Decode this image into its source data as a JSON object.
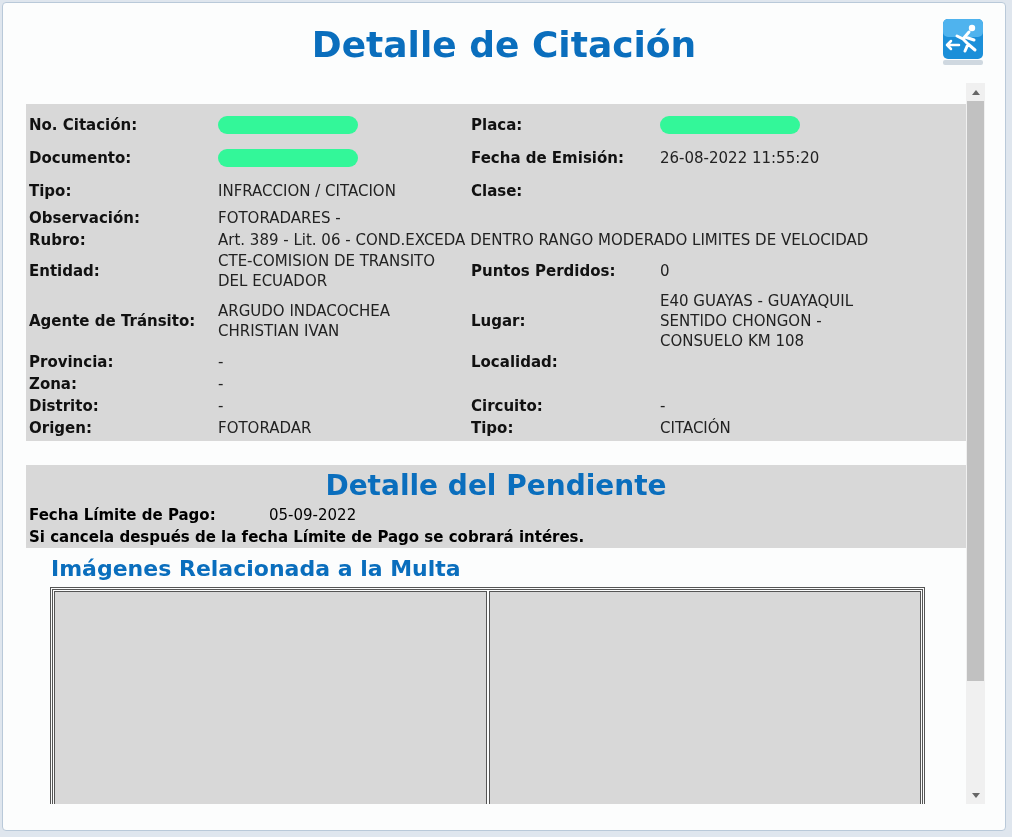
{
  "dialog": {
    "title": "Detalle de Citación"
  },
  "details": [
    {
      "kind": "pair",
      "cells": [
        {
          "label": "No. Citación:",
          "redacted": true
        },
        {
          "label": "Placa:",
          "redacted": true
        }
      ]
    },
    {
      "kind": "pair",
      "cells": [
        {
          "label": "Documento:",
          "redacted": true
        },
        {
          "label": "Fecha de Emisión:",
          "value": "26-08-2022 11:55:20"
        }
      ]
    },
    {
      "kind": "pair",
      "cells": [
        {
          "label": "Tipo:",
          "value": "INFRACCION / CITACION"
        },
        {
          "label": "Clase:"
        }
      ]
    },
    {
      "kind": "pair",
      "cells": [
        {
          "label": "Observación:",
          "value": "FOTORADARES -"
        }
      ]
    },
    {
      "kind": "wide",
      "cells": [
        {
          "label": "Rubro:",
          "value": "Art. 389 - Lit. 06 - COND.EXCEDA DENTRO RANGO MODERADO LIMITES DE VELOCIDAD"
        }
      ]
    },
    {
      "kind": "pair",
      "cells": [
        {
          "label": "Entidad:",
          "value": "CTE-COMISION DE TRANSITO DEL ECUADOR"
        },
        {
          "label": "Puntos Perdidos:",
          "value": "0"
        }
      ]
    },
    {
      "kind": "pair",
      "cells": [
        {
          "label": "Agente de Tránsito:",
          "value": "ARGUDO INDACOCHEA CHRISTIAN IVAN"
        },
        {
          "label": "Lugar:",
          "value": "E40 GUAYAS - GUAYAQUIL SENTIDO CHONGON - CONSUELO KM 108"
        }
      ]
    },
    {
      "kind": "pair",
      "cells": [
        {
          "label": "Provincia:",
          "value": "-"
        },
        {
          "label": "Localidad:"
        }
      ]
    },
    {
      "kind": "pair",
      "cells": [
        {
          "label": "Zona:",
          "value": "-"
        }
      ]
    },
    {
      "kind": "pair",
      "cells": [
        {
          "label": "Distrito:",
          "value": "-"
        },
        {
          "label": "Circuito:",
          "value": "-"
        }
      ]
    },
    {
      "kind": "pair",
      "cells": [
        {
          "label": "Origen:",
          "value": "FOTORADAR"
        },
        {
          "label": "Tipo:",
          "value": "CITACIÓN"
        }
      ]
    }
  ],
  "pending": {
    "title": "Detalle del Pendiente",
    "due_label": "Fecha Límite de Pago:",
    "due_value": "05-09-2022",
    "note": "Si cancela después de la fecha Límite de Pago se cobrará intéres."
  },
  "images": {
    "title": "Imágenes Relacionada a la Multa",
    "slots": [
      {
        "kind": "empty"
      },
      {
        "kind": "empty"
      }
    ]
  }
}
